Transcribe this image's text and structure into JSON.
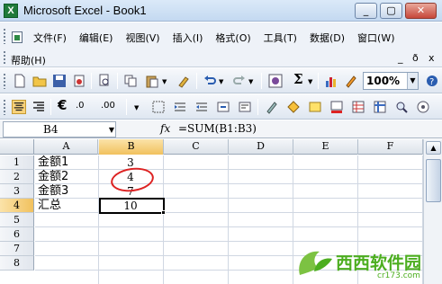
{
  "window": {
    "title": "Microsoft Excel - Book1",
    "app_icon_letter": "X"
  },
  "menu": {
    "items": [
      "文件(F)",
      "编辑(E)",
      "视图(V)",
      "插入(I)",
      "格式(O)",
      "工具(T)",
      "数据(D)",
      "窗口(W)"
    ],
    "help": "帮助(H)",
    "right": [
      "_",
      "ð",
      "x"
    ]
  },
  "toolbar": {
    "zoom": "100%"
  },
  "formula_bar": {
    "name_box": "B4",
    "fx": "fx",
    "formula": "=SUM(B1:B3)"
  },
  "sheet": {
    "columns": [
      "A",
      "B",
      "C",
      "D",
      "E",
      "F"
    ],
    "rows": [
      "1",
      "2",
      "3",
      "4",
      "5",
      "6",
      "7",
      "8"
    ],
    "data": [
      {
        "label": "金额1",
        "value": "3"
      },
      {
        "label": "金额2",
        "value": "4"
      },
      {
        "label": "金额3",
        "value": "7"
      },
      {
        "label": "汇总",
        "value": "10"
      }
    ],
    "selected_cell": "B4"
  },
  "watermark": {
    "text": "西西软件园",
    "sub": "cr173.com"
  },
  "colors": {
    "title_bar": "#c4d9f1",
    "selection_header": "#f1c15e",
    "annotation_circle": "#dd2222",
    "watermark_green": "#4cae1f"
  }
}
